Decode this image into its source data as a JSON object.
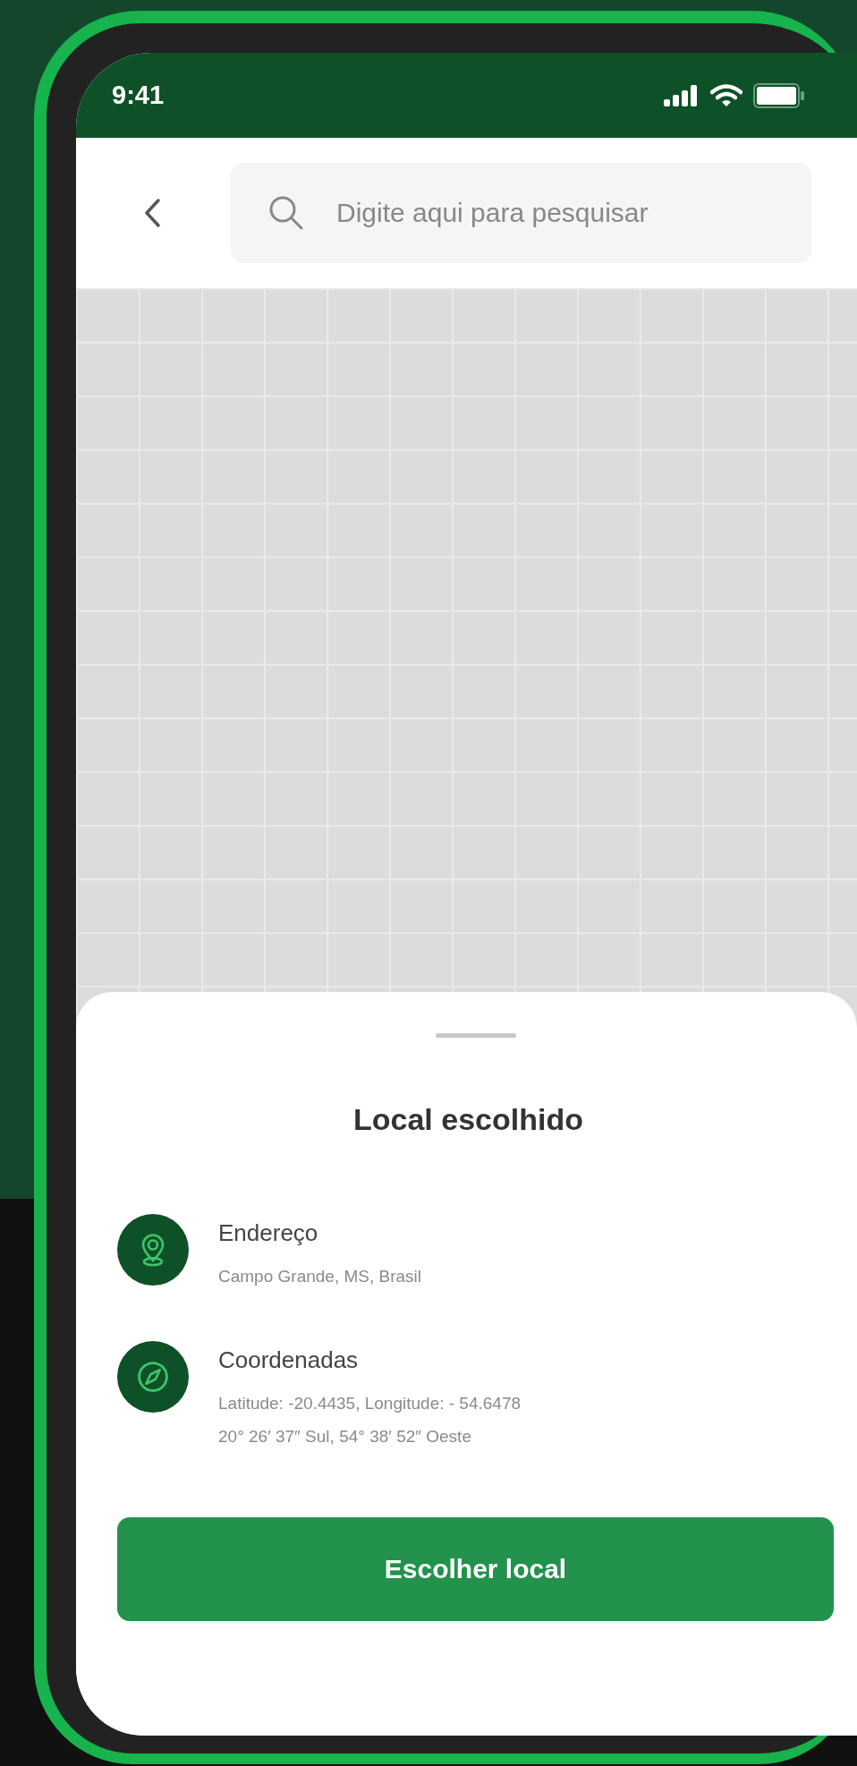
{
  "status_bar": {
    "time": "9:41"
  },
  "header": {
    "search": {
      "placeholder": "Digite aqui para pesquisar"
    }
  },
  "sheet": {
    "title": "Local escolhido",
    "items": [
      {
        "kind": "address",
        "label": "Endereço",
        "lines": [
          "Campo Grande, MS, Brasil"
        ]
      },
      {
        "kind": "coordinates",
        "label": "Coordenadas",
        "lines": [
          "Latitude: -20.4435, Longitude: - 54.6478",
          "20° 26′ 37″ Sul, 54° 38′ 52″ Oeste"
        ]
      }
    ],
    "button": "Escolher local"
  }
}
